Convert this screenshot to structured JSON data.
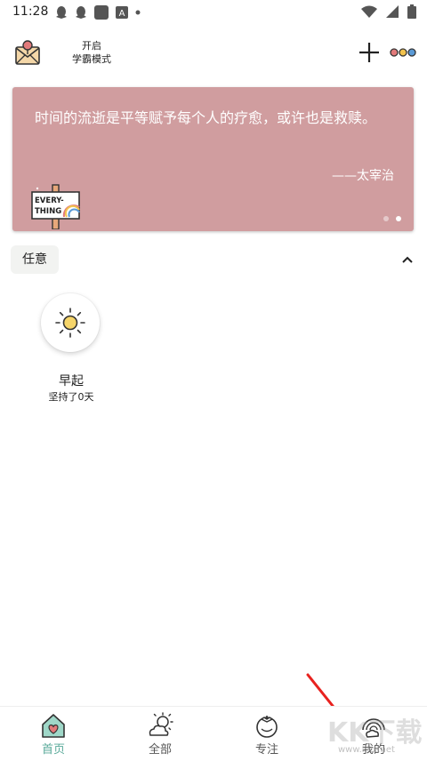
{
  "status_bar": {
    "time": "11:28",
    "left_icons": [
      "qq-icon",
      "qq-icon",
      "app-icon",
      "font-icon",
      "dot-icon"
    ],
    "right_icons": [
      "wifi-icon",
      "signal-icon",
      "battery-icon"
    ]
  },
  "header": {
    "mode_line1": "开启",
    "mode_line2": "学霸模式",
    "add_icon": "plus-icon",
    "more_icon": "three-dots-icon",
    "dot_colors": [
      "#e27a7a",
      "#f2c34e",
      "#5a9ad6"
    ]
  },
  "quote_card": {
    "text": "时间的流逝是平等赋予每个人的疗愈，或许也是救赎。",
    "author": "——太宰治",
    "sign_text_1": "EVERY-",
    "sign_text_2": "THING",
    "background": "#d09d9f",
    "active_page": 2,
    "page_count": 2
  },
  "category": {
    "label": "任意",
    "collapse_icon": "chevron-up-icon"
  },
  "habits": [
    {
      "name": "早起",
      "streak": "坚持了0天",
      "icon": "sun-icon"
    }
  ],
  "bottom_nav": {
    "active_color": "#5aaa9a",
    "items": [
      {
        "label": "首页",
        "icon": "home-heart-icon",
        "active": true
      },
      {
        "label": "全部",
        "icon": "sun-cloud-icon",
        "active": false
      },
      {
        "label": "专注",
        "icon": "tomato-icon",
        "active": false
      },
      {
        "label": "我的",
        "icon": "rainbow-cloud-icon",
        "active": false
      }
    ]
  },
  "overlay": {
    "watermark": "www.kkx.net",
    "watermark_logo": "KK下载"
  }
}
